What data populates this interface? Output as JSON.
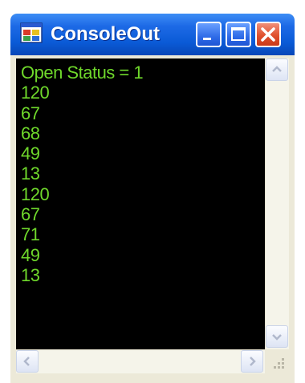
{
  "window": {
    "title": "ConsoleOut"
  },
  "console": {
    "lines": [
      "Open Status = 1",
      "120",
      "67",
      "68",
      "49",
      "13",
      "120",
      "67",
      "71",
      "49",
      "13"
    ]
  },
  "colors": {
    "text": "#6fd82b",
    "background": "#000000",
    "titlebar": "#0a5ad6"
  },
  "icons": {
    "app": "application-icon",
    "minimize": "minimize-icon",
    "maximize": "maximize-icon",
    "close": "close-icon"
  }
}
